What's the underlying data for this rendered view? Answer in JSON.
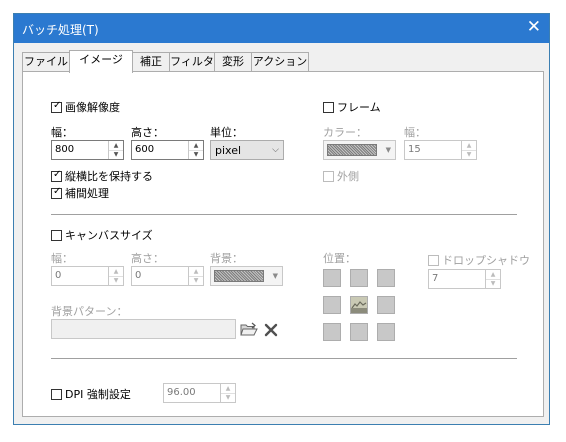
{
  "window": {
    "title": "バッチ処理(T)",
    "close_glyph": "✕"
  },
  "tabs": [
    "ファイル",
    "イメージ",
    "補正",
    "フィルタ",
    "変形",
    "アクション"
  ],
  "image": {
    "resize_label": "画像解像度",
    "width_label": "幅：",
    "height_label": "高さ：",
    "unit_label": "単位：",
    "width_value": "800",
    "height_value": "600",
    "unit_value": "pixel",
    "keep_aspect_label": "縦横比を保持する",
    "interpolation_label": "補間処理"
  },
  "frame": {
    "label": "フレーム",
    "color_label": "カラー：",
    "width_label": "幅：",
    "width_value": "15",
    "outside_label": "外側"
  },
  "canvas": {
    "label": "キャンバスサイズ",
    "width_label": "幅：",
    "height_label": "高さ：",
    "bg_label": "背景：",
    "width_value": "0",
    "height_value": "0",
    "position_label": "位置：",
    "shadow_label": "ドロップシャドウ",
    "shadow_value": "7",
    "pattern_label": "背景パターン："
  },
  "dpi": {
    "label": "DPI 強制設定",
    "value": "96.00"
  },
  "checks": {
    "resize": true,
    "frame": false,
    "keep_aspect": true,
    "interpolation": true,
    "outside": false,
    "canvas": false,
    "shadow": false,
    "dpi": false
  },
  "colors": {
    "titlebar": "#2b79d0",
    "accent_border": "#3c7fb1",
    "disabled_text": "#a0a0a0"
  },
  "icons": {
    "close": "close-icon",
    "folder": "folder-open-icon",
    "delete": "delete-x-icon",
    "spin": "spinner-arrows-icon"
  }
}
